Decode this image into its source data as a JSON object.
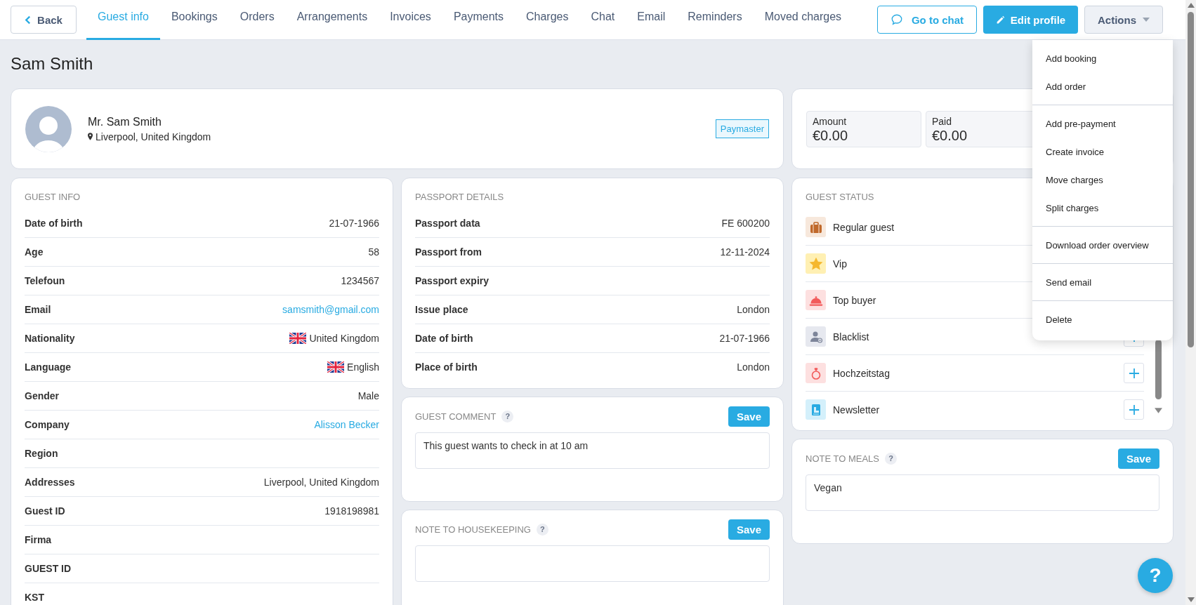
{
  "top_bar": {
    "back_button": "Back",
    "tabs": [
      {
        "label": "Guest info",
        "selected": true
      },
      {
        "label": "Bookings",
        "selected": false
      },
      {
        "label": "Orders",
        "selected": false
      },
      {
        "label": "Arrangements",
        "selected": false
      },
      {
        "label": "Invoices",
        "selected": false
      },
      {
        "label": "Payments",
        "selected": false
      },
      {
        "label": "Charges",
        "selected": false
      },
      {
        "label": "Chat",
        "selected": false
      },
      {
        "label": "Email",
        "selected": false
      },
      {
        "label": "Reminders",
        "selected": false
      },
      {
        "label": "Moved charges",
        "selected": false
      }
    ],
    "chat_button": "Go to chat",
    "edit_button": "Edit profile",
    "actions_button": "Actions"
  },
  "actions_menu": {
    "groups": [
      {
        "items": [
          "Add booking",
          "Add order"
        ]
      },
      {
        "items": [
          "Add pre-payment",
          "Create invoice",
          "Move charges",
          "Split charges"
        ]
      },
      {
        "items": [
          "Download order overview"
        ]
      },
      {
        "items": [
          "Send email"
        ]
      },
      {
        "items": [
          "Delete"
        ]
      }
    ]
  },
  "page_title": "Sam Smith",
  "profile": {
    "name": "Mr. Sam Smith",
    "location": "Liverpool, United Kingdom",
    "badge": "Paymaster"
  },
  "summary": [
    {
      "label": "Amount",
      "value": "€0.00"
    },
    {
      "label": "Paid",
      "value": "€0.00"
    }
  ],
  "guest_info": {
    "title": "GUEST INFO",
    "rows": [
      {
        "label": "Date of birth",
        "value": "21-07-1966",
        "kind": "text"
      },
      {
        "label": "Age",
        "value": "58",
        "kind": "text"
      },
      {
        "label": "Telefoun",
        "value": "1234567",
        "kind": "text"
      },
      {
        "label": "Email",
        "value": "samsmith@gmail.com",
        "kind": "link"
      },
      {
        "label": "Nationality",
        "value": "United Kingdom",
        "kind": "flag"
      },
      {
        "label": "Language",
        "value": "English",
        "kind": "flag"
      },
      {
        "label": "Gender",
        "value": "Male",
        "kind": "text"
      },
      {
        "label": "Company",
        "value": "Alisson Becker",
        "kind": "link"
      },
      {
        "label": "Region"
      },
      {
        "label": "Addresses",
        "value": "Liverpool, United Kingdom",
        "kind": "text"
      },
      {
        "label": "Guest ID",
        "value": "1918198981",
        "kind": "text"
      },
      {
        "label": "Firma"
      },
      {
        "label": "GUEST ID"
      },
      {
        "label": "KST"
      }
    ]
  },
  "passport": {
    "title": "PASSPORT DETAILS",
    "rows": [
      {
        "label": "Passport data",
        "value": "FE 600200"
      },
      {
        "label": "Passport from",
        "value": "12-11-2024"
      },
      {
        "label": "Passport expiry"
      },
      {
        "label": "Issue place",
        "value": "London"
      },
      {
        "label": "Date of birth",
        "value": "21-07-1966"
      },
      {
        "label": "Place of birth",
        "value": "London"
      }
    ]
  },
  "guest_comment": {
    "title": "GUEST COMMENT",
    "help": "?",
    "save": "Save",
    "value": "This guest wants to check in at 10 am"
  },
  "housekeeping": {
    "title": "NOTE TO HOUSEKEEPING",
    "help": "?",
    "save": "Save"
  },
  "guest_status": {
    "title": "GUEST STATUS",
    "items": [
      {
        "label": "Regular guest",
        "kind": "suitcase",
        "color": "#f7e8dc"
      },
      {
        "label": "Vip",
        "kind": "star",
        "color": "#fff0b3"
      },
      {
        "label": "Top buyer",
        "kind": "cloche",
        "color": "#fde0e0"
      },
      {
        "label": "Blacklist",
        "kind": "person",
        "color": "#e6e8ef",
        "add_button": true
      },
      {
        "label": "Hochzeitstag",
        "kind": "ring",
        "color": "#fde0e0",
        "add_button": true
      },
      {
        "label": "Newsletter",
        "kind": "card",
        "color": "#d4f0fb",
        "add_button": true
      }
    ]
  },
  "meals": {
    "title": "NOTE TO MEALS",
    "help": "?",
    "save": "Save",
    "value": "Vegan"
  },
  "help_button": "?"
}
